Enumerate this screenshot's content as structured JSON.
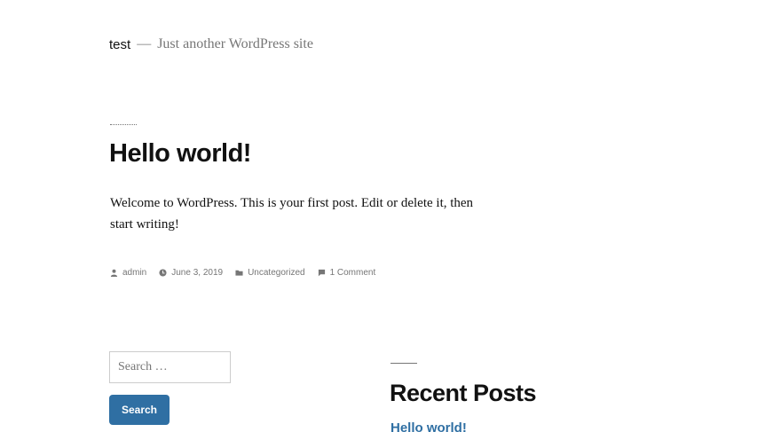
{
  "header": {
    "site_title": "test",
    "separator": "—",
    "tagline": "Just another WordPress site"
  },
  "post": {
    "title": "Hello world!",
    "content": "Welcome to WordPress. This is your first post. Edit or delete it, then start writing!",
    "meta": {
      "author": "admin",
      "date": "June 3, 2019",
      "category": "Uncategorized",
      "comments": "1 Comment"
    }
  },
  "search_widget": {
    "placeholder": "Search …",
    "button_label": "Search"
  },
  "recent_posts": {
    "title": "Recent Posts",
    "items": [
      {
        "label": "Hello world!"
      }
    ]
  },
  "colors": {
    "link": "#2f6fa3",
    "button": "#2f6fa3",
    "muted": "#767676",
    "text": "#111111"
  },
  "icons": [
    "person-icon",
    "clock-icon",
    "folder-icon",
    "comment-icon"
  ]
}
